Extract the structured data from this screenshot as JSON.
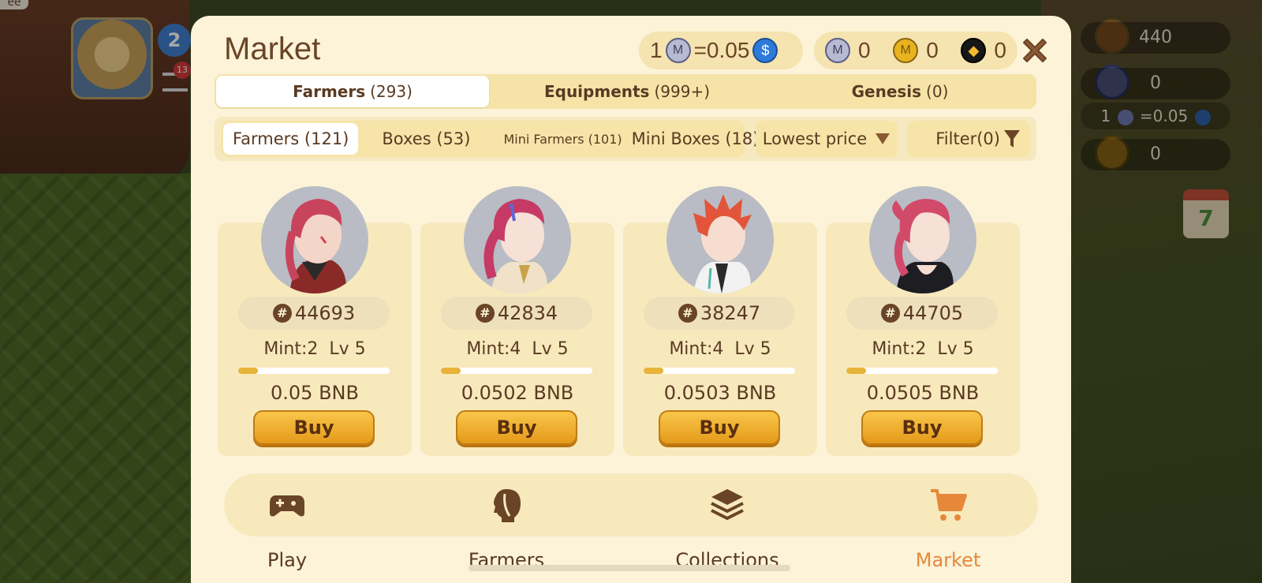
{
  "modal": {
    "title": "Market",
    "rate": {
      "left": "1",
      "right": "=0.05"
    },
    "wallet": [
      {
        "icon": "metal-coin-icon",
        "value": "0"
      },
      {
        "icon": "gold-coin-icon",
        "value": "0"
      },
      {
        "icon": "bnb-coin-icon",
        "value": "0"
      }
    ]
  },
  "top_tabs": [
    {
      "label": "Farmers",
      "count": "(293)"
    },
    {
      "label": "Equipments",
      "count": "(999+)"
    },
    {
      "label": "Genesis",
      "count": "(0)"
    }
  ],
  "sub_tabs": [
    {
      "label": "Farmers (121)"
    },
    {
      "label": "Boxes (53)"
    },
    {
      "label": "Mini Farmers (101)"
    },
    {
      "label": "Mini Boxes (18)"
    }
  ],
  "sort": {
    "label": "Lowest price"
  },
  "filter": {
    "label": "Filter(0)"
  },
  "cards": [
    {
      "id": "44693",
      "mint": "Mint:2",
      "level": "Lv 5",
      "price": "0.05 BNB",
      "progress": 0.13,
      "buy": "Buy",
      "hair": "#c8445c"
    },
    {
      "id": "42834",
      "mint": "Mint:4",
      "level": "Lv 5",
      "price": "0.0502 BNB",
      "progress": 0.13,
      "buy": "Buy",
      "hair": "#c63a66"
    },
    {
      "id": "38247",
      "mint": "Mint:4",
      "level": "Lv 5",
      "price": "0.0503 BNB",
      "progress": 0.13,
      "buy": "Buy",
      "hair": "#e2553a"
    },
    {
      "id": "44705",
      "mint": "Mint:2",
      "level": "Lv 5",
      "price": "0.0505 BNB",
      "progress": 0.13,
      "buy": "Buy",
      "hair": "#d24a6a"
    }
  ],
  "nav": [
    {
      "label": "Play",
      "icon": "gamepad-icon"
    },
    {
      "label": "Farmers",
      "icon": "farmer-head-icon"
    },
    {
      "label": "Collections",
      "icon": "layers-icon"
    },
    {
      "label": "Market",
      "icon": "cart-icon"
    }
  ],
  "background_hud": [
    {
      "value": "440"
    },
    {
      "value": "0"
    },
    {
      "left": "1",
      "right": "=0.05"
    },
    {
      "value": "0"
    }
  ],
  "background_badges": {
    "level": "2",
    "notifications": "13",
    "calendar_day": "7",
    "corner_label": "ee"
  },
  "colors": {
    "modal_bg": "#fcf3d9",
    "tab_bg": "#f6e3a8",
    "card_bg": "#f8e9bd",
    "text_brown": "#5a3a22",
    "accent_orange": "#e5883a",
    "buy_button": "#f5b52e"
  }
}
